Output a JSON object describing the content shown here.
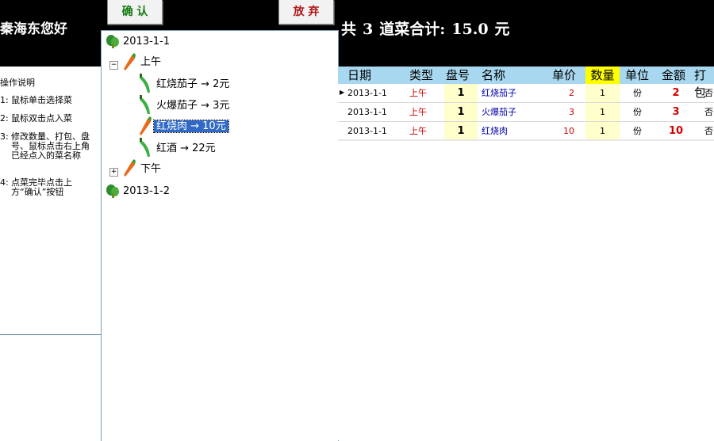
{
  "header": {
    "greeting": "秦海东您好",
    "confirm_label": "确 认",
    "cancel_label": "放 弃",
    "total_prefix": "共",
    "total_count": "3",
    "total_mid": "道菜合计:",
    "total_amount": "15.0",
    "total_unit": "元"
  },
  "instructions": {
    "title": "操作说明",
    "items": [
      {
        "num": "1:",
        "text": "鼠标单击选择菜"
      },
      {
        "num": "2:",
        "text": "鼠标双击点入菜"
      },
      {
        "num": "3:",
        "text": "修改数量、打包、盘号、鼠标点击右上角已经点入的菜名称"
      },
      {
        "num": "4:",
        "text": "点菜完毕点击上方“确认”按钮"
      }
    ]
  },
  "tree": {
    "date1": "2013-1-1",
    "morning": "上午",
    "dishes": [
      {
        "label": "红烧茄子 → 2元"
      },
      {
        "label": "火爆茄子 → 3元"
      },
      {
        "label": "红烧肉 → 10元"
      },
      {
        "label": "红酒 → 22元"
      }
    ],
    "afternoon": "下午",
    "date2": "2013-1-2",
    "icons": {
      "date": "vegetable-icon",
      "period": "carrot-icon",
      "dish": "pepper-icon"
    }
  },
  "grid": {
    "headers": [
      "日期",
      "类型",
      "盘号",
      "名称",
      "单价",
      "数量",
      "单位",
      "金额",
      "打包"
    ],
    "rows": [
      {
        "date": "2013-1-1",
        "type": "上午",
        "plate": "1",
        "name": "红烧茄子",
        "price": "2",
        "qty": "1",
        "unit": "份",
        "amount": "2",
        "pack": "否"
      },
      {
        "date": "2013-1-1",
        "type": "上午",
        "plate": "1",
        "name": "火爆茄子",
        "price": "3",
        "qty": "1",
        "unit": "份",
        "amount": "3",
        "pack": "否"
      },
      {
        "date": "2013-1-1",
        "type": "上午",
        "plate": "1",
        "name": "红烧肉",
        "price": "10",
        "qty": "1",
        "unit": "份",
        "amount": "10",
        "pack": "否"
      }
    ]
  },
  "colors": {
    "header_bg": "#000000",
    "grid_header": "#a8d8f0",
    "qty_header": "#ffff00",
    "selection": "#316ac5"
  }
}
